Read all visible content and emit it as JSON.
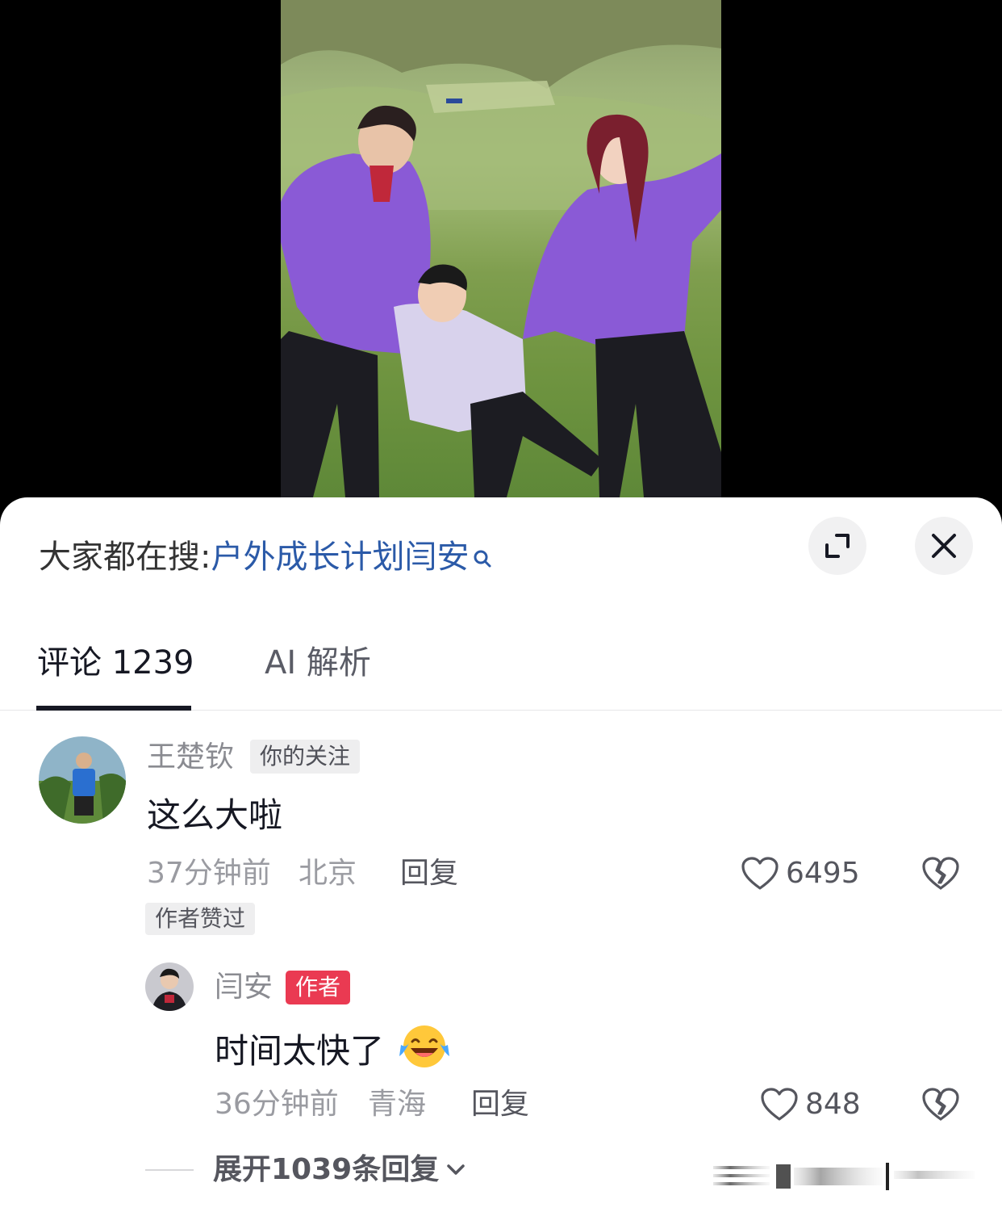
{
  "search": {
    "prefix": "大家都在搜:",
    "query": "户外成长计划闫安"
  },
  "tabs": [
    {
      "label": "评论 1239",
      "active": true
    },
    {
      "label": "AI 解析",
      "active": false
    }
  ],
  "comment": {
    "username": "王楚钦",
    "follow_tag": "你的关注",
    "text": "这么大啦",
    "time": "37分钟前",
    "location": "北京",
    "reply_label": "回复",
    "likes": "6495",
    "liked_by_author": "作者赞过"
  },
  "reply": {
    "username": "闫安",
    "author_tag": "作者",
    "text": "时间太快了",
    "time": "36分钟前",
    "location": "青海",
    "reply_label": "回复",
    "likes": "848"
  },
  "expand_replies": "展开1039条回复",
  "colors": {
    "search_query": "#2b5aa8",
    "author_tag_bg": "#ea3a52",
    "jacket": "#8a5ad6"
  }
}
